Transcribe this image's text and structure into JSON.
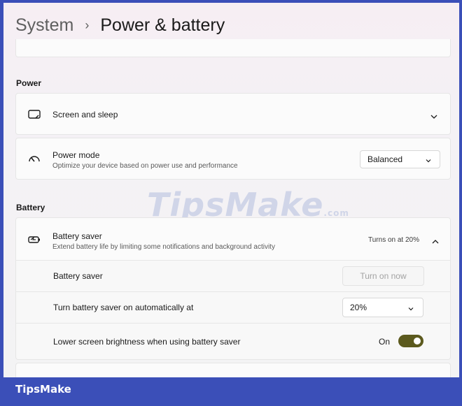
{
  "breadcrumb": {
    "parent": "System",
    "separator": "›",
    "current": "Power & battery"
  },
  "power": {
    "section_label": "Power",
    "screen_sleep": {
      "title": "Screen and sleep",
      "icon": "monitor-icon"
    },
    "power_mode": {
      "title": "Power mode",
      "subtitle": "Optimize your device based on power use and performance",
      "icon": "gauge-icon",
      "selected": "Balanced"
    }
  },
  "battery": {
    "section_label": "Battery",
    "saver": {
      "title": "Battery saver",
      "subtitle": "Extend battery life by limiting some notifications and background activity",
      "status": "Turns on at 20%",
      "icon": "battery-saver-icon"
    },
    "saver_now": {
      "label": "Battery saver",
      "button": "Turn on now"
    },
    "auto_on": {
      "label": "Turn battery saver on automatically at",
      "selected": "20%"
    },
    "brightness": {
      "label": "Lower screen brightness when using battery saver",
      "state": "On",
      "on": true
    }
  },
  "watermark": {
    "text": "TipsMake",
    "suffix": ".com"
  },
  "footer": {
    "brand": "TipsMake"
  },
  "colors": {
    "toggle_on": "#5c5a1e",
    "frame": "#3b4fb8"
  }
}
